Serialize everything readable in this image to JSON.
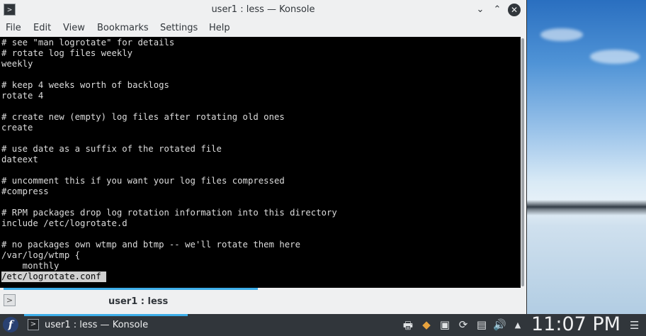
{
  "window": {
    "title": "user1 : less — Konsole",
    "app_icon": ">",
    "minimize": "⌄",
    "maximize": "⌃",
    "close": "✕"
  },
  "menubar": {
    "items": [
      "File",
      "Edit",
      "View",
      "Bookmarks",
      "Settings",
      "Help"
    ]
  },
  "terminal": {
    "lines": [
      "# see \"man logrotate\" for details",
      "# rotate log files weekly",
      "weekly",
      "",
      "# keep 4 weeks worth of backlogs",
      "rotate 4",
      "",
      "# create new (empty) log files after rotating old ones",
      "create",
      "",
      "# use date as a suffix of the rotated file",
      "dateext",
      "",
      "# uncomment this if you want your log files compressed",
      "#compress",
      "",
      "# RPM packages drop log rotation information into this directory",
      "include /etc/logrotate.d",
      "",
      "# no packages own wtmp and btmp -- we'll rotate them here",
      "/var/log/wtmp {",
      "    monthly"
    ],
    "prompt": "/etc/logrotate.conf "
  },
  "tabbar": {
    "new_tab_icon": ">",
    "active_tab": "user1 : less"
  },
  "taskbar": {
    "start_glyph": "f",
    "task_icon": ">",
    "task_label": "user1 : less — Konsole",
    "tray_icons": [
      "printer-icon",
      "package-updater-icon",
      "display-icon",
      "update-icon",
      "clipboard-icon",
      "volume-icon",
      "expand-tray-icon"
    ],
    "tray_glyphs": [
      "🖶",
      "◆",
      "▣",
      "⟳",
      "▤",
      "🔊",
      "▲"
    ],
    "clock": "11:07 PM",
    "menu_glyph": "☰"
  },
  "colors": {
    "accent": "#3daee9",
    "terminal_bg": "#000000",
    "terminal_fg": "#dcdcdc",
    "panel_bg": "#31363b",
    "window_bg": "#eff0f1"
  }
}
